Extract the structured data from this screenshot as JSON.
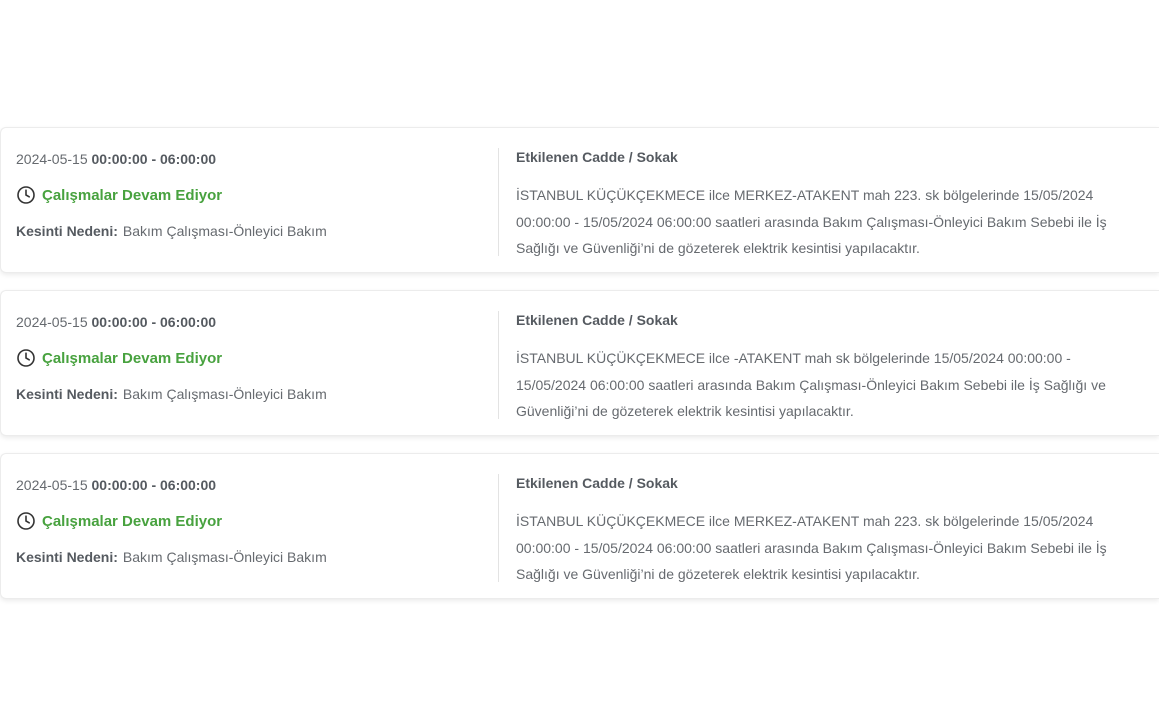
{
  "outages": [
    {
      "date": "2024-05-15",
      "time_range": "00:00:00 - 06:00:00",
      "status": "Çalışmalar Devam Ediyor",
      "reason_label": "Kesinti Nedeni:",
      "reason_value": "Bakım Çalışması-Önleyici Bakım",
      "affected_heading": "Etkilenen Cadde / Sokak",
      "description": "İSTANBUL KÜÇÜKÇEKMECE ilce MERKEZ-ATAKENT mah 223. sk bölgelerinde 15/05/2024 00:00:00 - 15/05/2024 06:00:00 saatleri arasında Bakım Çalışması-Önleyici Bakım Sebebi ile İş Sağlığı ve Güvenliği’ni de gözeterek elektrik kesintisi yapılacaktır."
    },
    {
      "date": "2024-05-15",
      "time_range": "00:00:00 - 06:00:00",
      "status": "Çalışmalar Devam Ediyor",
      "reason_label": "Kesinti Nedeni:",
      "reason_value": "Bakım Çalışması-Önleyici Bakım",
      "affected_heading": "Etkilenen Cadde / Sokak",
      "description": "İSTANBUL KÜÇÜKÇEKMECE ilce -ATAKENT mah sk bölgelerinde 15/05/2024 00:00:00 - 15/05/2024 06:00:00 saatleri arasında Bakım Çalışması-Önleyici Bakım Sebebi ile İş Sağlığı ve Güvenliği’ni de gözeterek elektrik kesintisi yapılacaktır."
    },
    {
      "date": "2024-05-15",
      "time_range": "00:00:00 - 06:00:00",
      "status": "Çalışmalar Devam Ediyor",
      "reason_label": "Kesinti Nedeni:",
      "reason_value": "Bakım Çalışması-Önleyici Bakım",
      "affected_heading": "Etkilenen Cadde / Sokak",
      "description": "İSTANBUL KÜÇÜKÇEKMECE ilce MERKEZ-ATAKENT mah 223. sk bölgelerinde 15/05/2024 00:00:00 - 15/05/2024 06:00:00 saatleri arasında Bakım Çalışması-Önleyici Bakım Sebebi ile İş Sağlığı ve Güvenliği’ni de gözeterek elektrik kesintisi yapılacaktır."
    }
  ],
  "icons": {
    "status_icon": "clock-icon"
  },
  "colors": {
    "status": "#48a23f",
    "text": "#666a6f",
    "heading": "#555a60",
    "divider": "#e3e3e3"
  }
}
